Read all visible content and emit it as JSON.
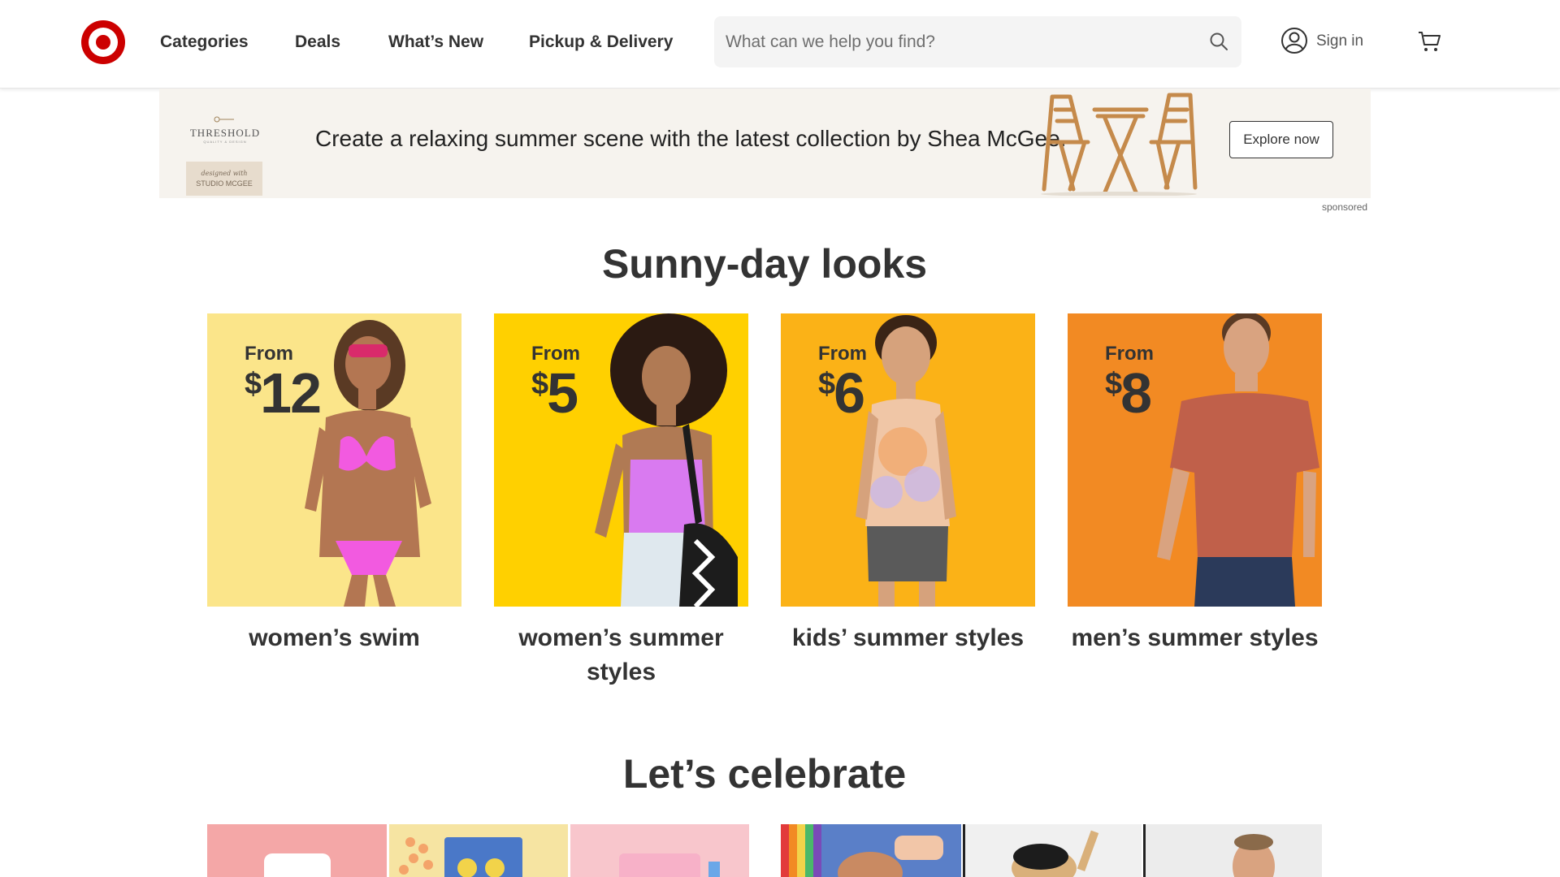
{
  "header": {
    "logo_name": "Target",
    "nav": [
      "Categories",
      "Deals",
      "What’s New",
      "Pickup & Delivery"
    ],
    "search": {
      "placeholder": "What can we help you find?",
      "icon": "search-icon"
    },
    "sign_in": "Sign in",
    "cart_icon": "cart-icon",
    "brand_color": "#cc0000"
  },
  "banner": {
    "brand": "THRESHOLD",
    "studio_cursive": "designed with",
    "studio": "STUDIO MCGEE",
    "text": "Create a relaxing summer scene with the latest collection by Shea McGee.",
    "cta": "Explore now",
    "sponsored": "sponsored"
  },
  "sunny": {
    "title": "Sunny-day looks",
    "cards": [
      {
        "from": "From",
        "dollar": "$",
        "amount": "12",
        "label": "women’s swim",
        "bg": "#fbe58a"
      },
      {
        "from": "From",
        "dollar": "$",
        "amount": "5",
        "label": "women’s summer styles",
        "bg": "#ffd000"
      },
      {
        "from": "From",
        "dollar": "$",
        "amount": "6",
        "label": "kids’ summer styles",
        "bg": "#fbb217"
      },
      {
        "from": "From",
        "dollar": "$",
        "amount": "8",
        "label": "men’s summer styles",
        "bg": "#f28a23"
      }
    ]
  },
  "celebrate": {
    "title": "Let’s celebrate"
  }
}
